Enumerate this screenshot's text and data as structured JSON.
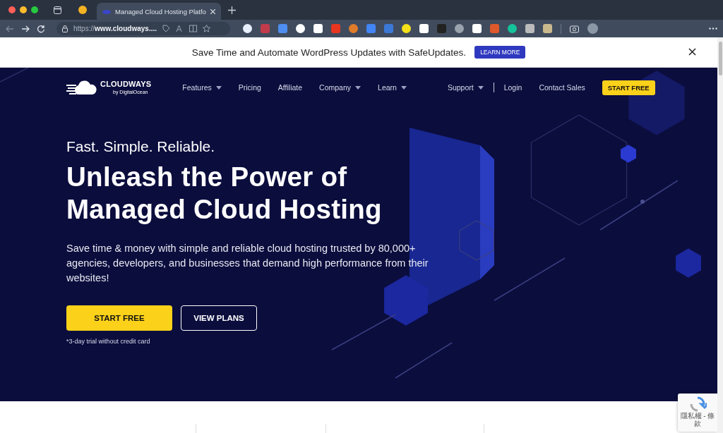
{
  "browser": {
    "tabs": [
      {
        "kind": "pinned",
        "selected": false
      },
      {
        "kind": "page",
        "title": "Managed Cloud Hosting Platfo",
        "selected": true
      }
    ],
    "url": "https://**www.cloudways....**"
  },
  "banner": {
    "text": "Save Time and Automate WordPress Updates with SafeUpdates.",
    "button": "LEARN MORE"
  },
  "nav": {
    "logo": "CLOUDWAYS",
    "logo_sub": "by DigitalOcean",
    "items": [
      {
        "label": "Features",
        "dropdown": true
      },
      {
        "label": "Pricing",
        "dropdown": false
      },
      {
        "label": "Affiliate",
        "dropdown": false
      },
      {
        "label": "Company",
        "dropdown": true
      },
      {
        "label": "Learn",
        "dropdown": true
      }
    ],
    "right_items": [
      {
        "label": "Support",
        "dropdown": true
      },
      {
        "label": "Login",
        "dropdown": false
      },
      {
        "label": "Contact Sales",
        "dropdown": false
      }
    ],
    "cta": "START FREE"
  },
  "hero": {
    "kicker": "Fast. Simple. Reliable.",
    "title_lines": [
      "Unleash the Power of",
      "Managed Cloud Hosting"
    ],
    "description": "Save time & money with simple and reliable cloud hosting trusted by 80,000+ agencies, developers, and businesses that demand high performance from their websites!",
    "primary_button": "START FREE",
    "secondary_button": "VIEW PLANS",
    "note": "*3-day trial without credit card"
  },
  "recaptcha": {
    "text": "隱私權 - 條款"
  }
}
